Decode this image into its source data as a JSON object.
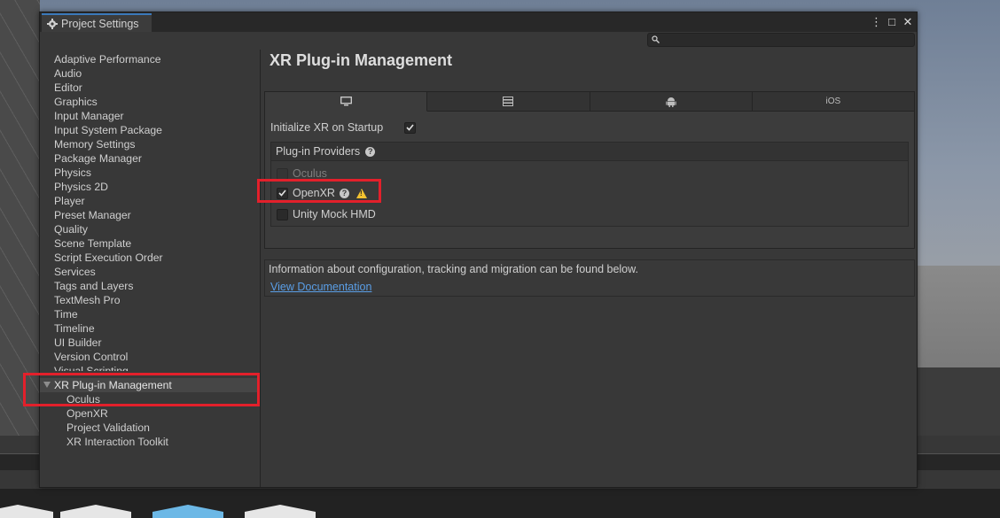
{
  "window": {
    "tab_title": "Project Settings",
    "controls": [
      "more-icon",
      "maximize-icon",
      "close-icon"
    ]
  },
  "search": {
    "placeholder": "",
    "value": ""
  },
  "sidebar": {
    "items": [
      {
        "label": "Adaptive Performance"
      },
      {
        "label": "Audio"
      },
      {
        "label": "Editor"
      },
      {
        "label": "Graphics"
      },
      {
        "label": "Input Manager"
      },
      {
        "label": "Input System Package"
      },
      {
        "label": "Memory Settings"
      },
      {
        "label": "Package Manager"
      },
      {
        "label": "Physics"
      },
      {
        "label": "Physics 2D"
      },
      {
        "label": "Player"
      },
      {
        "label": "Preset Manager"
      },
      {
        "label": "Quality"
      },
      {
        "label": "Scene Template"
      },
      {
        "label": "Script Execution Order"
      },
      {
        "label": "Services"
      },
      {
        "label": "Tags and Layers"
      },
      {
        "label": "TextMesh Pro"
      },
      {
        "label": "Time"
      },
      {
        "label": "Timeline"
      },
      {
        "label": "UI Builder"
      },
      {
        "label": "Version Control"
      },
      {
        "label": "Visual Scripting"
      }
    ],
    "selected": {
      "label": "XR Plug-in Management",
      "expanded": true
    },
    "children": [
      {
        "label": "Oculus"
      },
      {
        "label": "OpenXR"
      },
      {
        "label": "Project Validation"
      },
      {
        "label": "XR Interaction Toolkit"
      }
    ]
  },
  "main": {
    "title": "XR Plug-in Management",
    "platform_tabs": [
      {
        "icon": "monitor-icon",
        "label": "",
        "active": true
      },
      {
        "icon": "server-icon",
        "label": "",
        "active": false
      },
      {
        "icon": "android-icon",
        "label": "",
        "active": false
      },
      {
        "icon": "ios-label",
        "label": "iOS",
        "active": false
      }
    ],
    "init_label": "Initialize XR on Startup",
    "init_checked": true,
    "providers_header": "Plug-in Providers",
    "providers": [
      {
        "label": "Oculus",
        "checked": false,
        "disabled": true
      },
      {
        "label": "OpenXR",
        "checked": true,
        "disabled": false,
        "help": true,
        "warning": true
      },
      {
        "label": "Unity Mock HMD",
        "checked": false,
        "disabled": false
      }
    ],
    "info_text": "Information about configuration, tracking and migration can be found below.",
    "info_link": "View Documentation"
  },
  "colors": {
    "highlight": "#e3202b",
    "link": "#5a9ee6",
    "warning": "#f2c230",
    "tab_accent": "#3a79bb"
  }
}
